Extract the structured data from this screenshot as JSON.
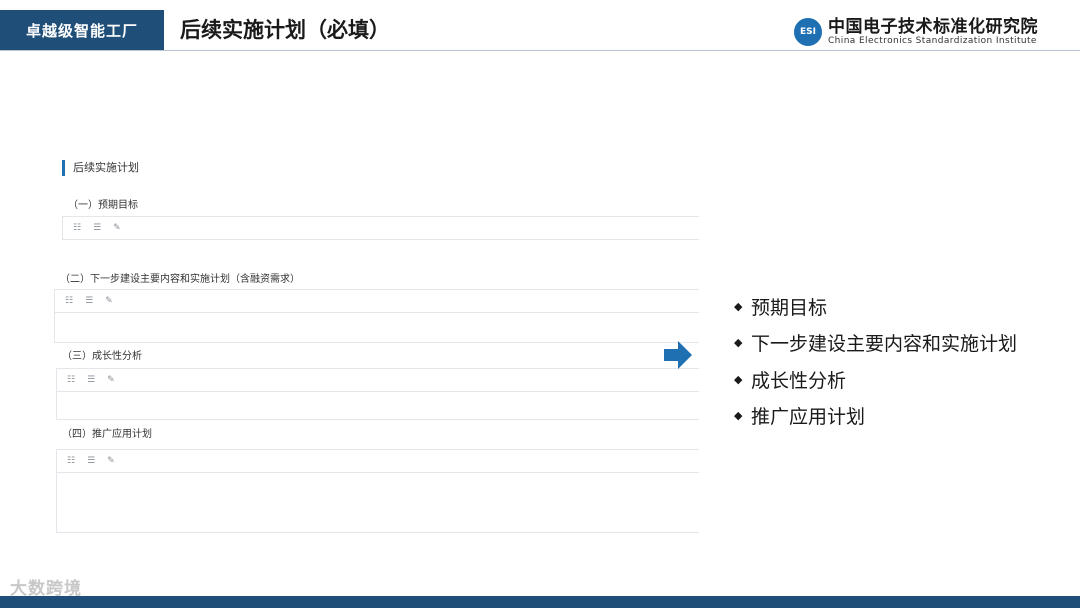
{
  "header": {
    "tag": "卓越级智能工厂",
    "title": "后续实施计划（必填）",
    "logo_mark": "ESI",
    "logo_cn": "中国电子技术标准化研究院",
    "logo_en": "China Electronics Standardization Institute"
  },
  "form": {
    "heading": "后续实施计划",
    "sections": [
      {
        "label": "（一）预期目标"
      },
      {
        "label": "（二）下一步建设主要内容和实施计划（含融资需求）"
      },
      {
        "label": "（三）成长性分析"
      },
      {
        "label": "（四）推广应用计划"
      }
    ],
    "toolbar_icons": [
      "ordered-list-icon",
      "unordered-list-icon",
      "edit-icon"
    ],
    "toolbar_glyphs": [
      "☷",
      "☰",
      "✎"
    ]
  },
  "summary": {
    "items": [
      "预期目标",
      "下一步建设主要内容和实施计划",
      "成长性分析",
      "推广应用计划"
    ],
    "bullet": "◆"
  },
  "footer": {
    "watermark": "大数跨境"
  },
  "colors": {
    "brand_navy": "#1f4e79",
    "accent_blue": "#1f6fb3",
    "arrow": "#1f6fb3"
  }
}
